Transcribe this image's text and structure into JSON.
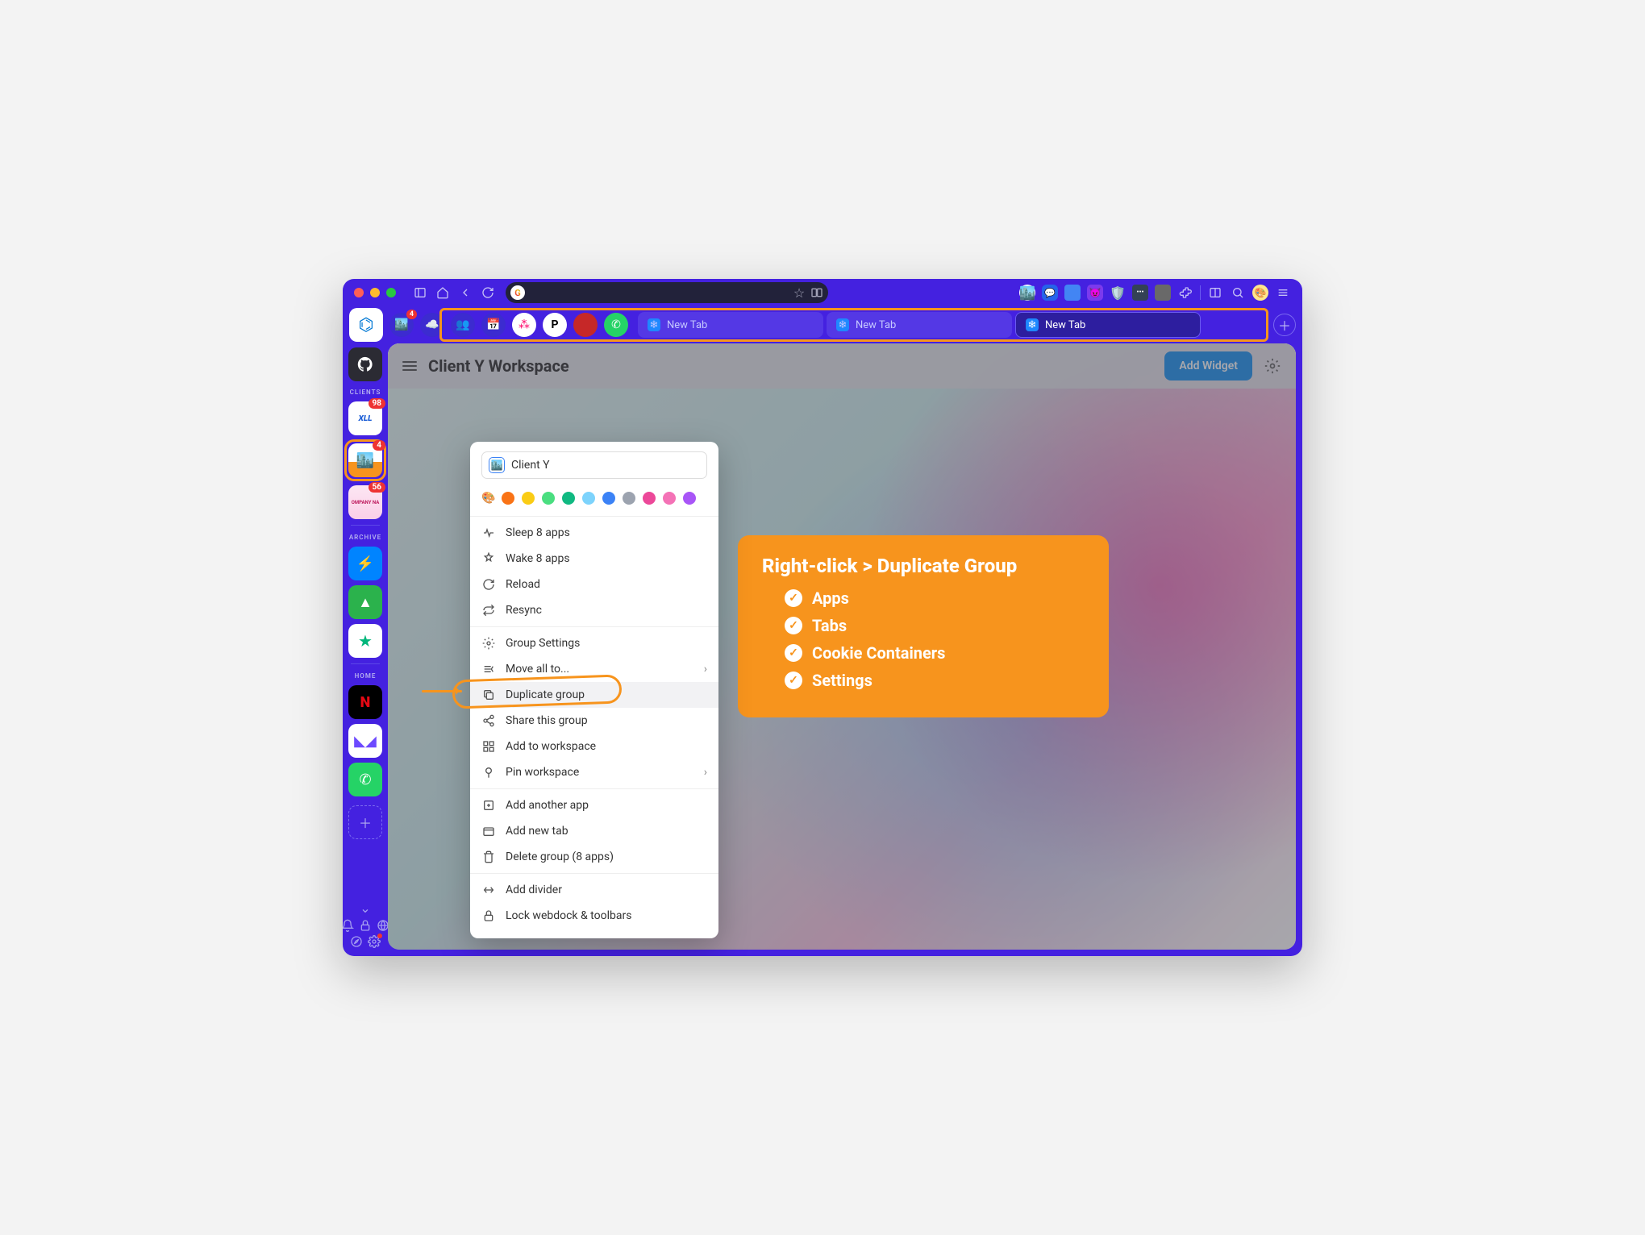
{
  "sidebar": {
    "section_clients": "CLIENTS",
    "section_archive": "ARCHIVE",
    "section_home": "HOME",
    "apps": {
      "xll_badge": "98",
      "clienty_badge": "4",
      "company_badge": "56"
    }
  },
  "pinned_badge": "4",
  "tabs": [
    {
      "label": "New Tab",
      "active": false
    },
    {
      "label": "New Tab",
      "active": false
    },
    {
      "label": "New Tab",
      "active": true
    }
  ],
  "header": {
    "title": "Client Y Workspace",
    "add_widget": "Add Widget"
  },
  "context_menu": {
    "input": "Client Y",
    "colors": [
      "#2563eb",
      "#f97316",
      "#facc15",
      "#22c55e",
      "#10b981",
      "#38bdf8",
      "#3b82f6",
      "#9ca3af",
      "#ec4899",
      "#f472b6",
      "#a855f7"
    ],
    "items": {
      "sleep": "Sleep 8 apps",
      "wake": "Wake 8 apps",
      "reload": "Reload",
      "resync": "Resync",
      "group_settings": "Group Settings",
      "move_all": "Move all to...",
      "duplicate": "Duplicate group",
      "share": "Share this group",
      "add_workspace": "Add to workspace",
      "pin_workspace": "Pin workspace",
      "add_app": "Add another app",
      "add_tab": "Add new tab",
      "delete_group": "Delete group (8 apps)",
      "add_divider": "Add divider",
      "lock": "Lock webdock & toolbars"
    }
  },
  "callout": {
    "title": "Right-click > Duplicate Group",
    "items": [
      "Apps",
      "Tabs",
      "Cookie Containers",
      "Settings"
    ]
  }
}
